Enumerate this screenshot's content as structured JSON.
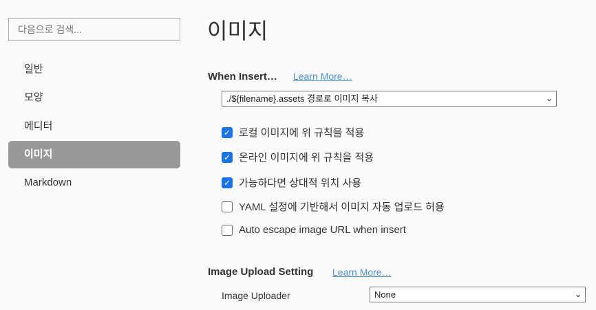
{
  "sidebar": {
    "search_placeholder": "다음으로 검색...",
    "items": [
      {
        "label": "일반"
      },
      {
        "label": "모양"
      },
      {
        "label": "에디터"
      },
      {
        "label": "이미지",
        "active": true
      },
      {
        "label": "Markdown"
      }
    ]
  },
  "main": {
    "title": "이미지",
    "when_insert": {
      "heading": "When Insert…",
      "learn_more": "Learn More…",
      "select_value": "./${filename}.assets 경로로 이미지 복사",
      "options": [
        {
          "label": "로컬 이미지에 위 규칙을 적용",
          "checked": true
        },
        {
          "label": "온라인 이미지에 위 규칙을 적용",
          "checked": true
        },
        {
          "label": "가능하다면 상대적 위치 사용",
          "checked": true
        },
        {
          "label": "YAML 설정에 기반해서 이미지 자동 업로드 허용",
          "checked": false
        },
        {
          "label": "Auto escape image URL when insert",
          "checked": false
        }
      ]
    },
    "upload": {
      "heading": "Image Upload Setting",
      "learn_more": "Learn More…",
      "uploader_label": "Image Uploader",
      "uploader_value": "None"
    }
  },
  "colors": {
    "accent": "#1a73e8",
    "link": "#4a8fd4",
    "active_nav": "#999999"
  }
}
